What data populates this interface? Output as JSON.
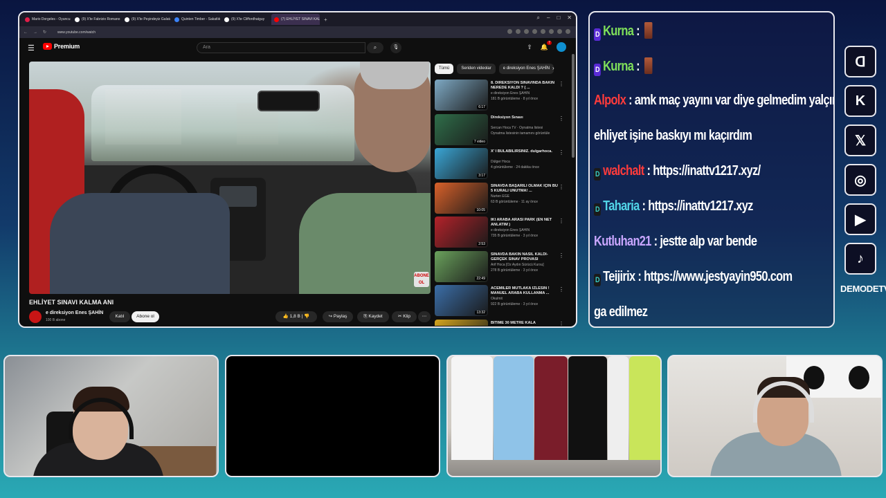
{
  "browser": {
    "tabs": [
      {
        "label": "Mario Dorgeles - Oyuncu",
        "color": "#e11d48"
      },
      {
        "label": "(9) X'te Fabrizio Romano",
        "color": "#ffffff"
      },
      {
        "label": "(9) X'te Peşindeyiz Galata",
        "color": "#ffffff"
      },
      {
        "label": "Quinten Timber - Sakatlık",
        "color": "#3b82f6"
      },
      {
        "label": "(9) X'te Cliffordhatguy",
        "color": "#ffffff"
      },
      {
        "label": "(7) EHLİYET SINAVI KALM",
        "color": "#ff0000"
      }
    ],
    "url": "www.youtube.com/watch"
  },
  "youtube": {
    "logo_text": "Premium",
    "search_placeholder": "Ara",
    "notification_count": "7",
    "video": {
      "title": "EHLİYET SINAVI KALMA ANI",
      "overlay_badge": "ABONE OL",
      "channel": "e direksiyon Enes ŞAHİN",
      "subscribers": "100 B abone",
      "join_label": "Katıl",
      "subscribe_label": "Abone ol",
      "likes": "1,8 B",
      "share_label": "Paylaş",
      "save_label": "Kaydet",
      "clip_label": "Klip"
    },
    "chips": [
      "Tümü",
      "Seriden videolar",
      "e direksiyon Enes ŞAHİN"
    ],
    "recommendations": [
      {
        "title": "8. DİREKSİYON SINAVINDA BAKIN NEREDE KALDI ? ( ...",
        "channel": "e direksiyon Enes ŞAHİN",
        "meta": "181 B görüntüleme · 8 yıl önce",
        "duration": "6:17",
        "color": "#7ea9c4"
      },
      {
        "title": "Direksiyon Sınavı",
        "channel": "Sercan Hoca TV · Oynatma listesi",
        "meta": "Oynatma listesinin tamamını görüntüle",
        "duration": "7 video",
        "color": "#2f6e4a"
      },
      {
        "title": "X' I BULABİLİRSİNİZ. dulgarhoca.",
        "channel": "Dülger Hoca",
        "meta": "4 görüntüleme · 24 dakika önce",
        "duration": "3:17",
        "color": "#3aa6d6"
      },
      {
        "title": "SINAVDA BAŞARILI OLMAK İÇİN BU 5 KURALI UNUTMA! ...",
        "channel": "Nurten EGE",
        "meta": "63 B görüntüleme · 11 ay önce",
        "duration": "10:05",
        "color": "#d9612a"
      },
      {
        "title": "İKİ ARABA ARASI PARK (EN NET ANLATIM )",
        "channel": "e direksiyon Enes ŞAHİN",
        "meta": "735 B görüntüleme · 3 yıl önce",
        "duration": "2:53",
        "color": "#b4222a"
      },
      {
        "title": "SINAVDA BAKIN NASIL KALDI- GERÇEK SINAV PROVASI",
        "channel": "Arif Hoca [Öz Aydın Sürücü Kursu]",
        "meta": "278 B görüntüleme · 3 yıl önce",
        "duration": "22:49",
        "color": "#6aa15c"
      },
      {
        "title": "ACEMİLER MUTLAKA İZLESİN ! MANUEL ARABA KULLANMA ...",
        "channel": "Okulmit",
        "meta": "922 B görüntüleme · 3 yıl önce",
        "duration": "13:32",
        "color": "#3b6ea8"
      },
      {
        "title": "BİTİME 30 METRE KALA",
        "channel": "",
        "meta": "",
        "duration": "",
        "color": "#d4a51f"
      }
    ]
  },
  "chat": {
    "messages": [
      {
        "user": "Kurna",
        "user_color": "#7fe05a",
        "badge": "D",
        "badge_style": "purple",
        "text": "",
        "emote": true
      },
      {
        "user": "Kurna",
        "user_color": "#7fe05a",
        "badge": "D",
        "badge_style": "purple",
        "text": "",
        "emote": true
      },
      {
        "user": "Alpolx",
        "user_color": "#ff3b3b",
        "badge": "",
        "badge_style": "",
        "text": "amk maç yayını var diye gelmedim yalçının",
        "emote": false
      },
      {
        "user": "",
        "user_color": "#ffffff",
        "badge": "",
        "badge_style": "",
        "text": "ehliyet işine baskıyı mı kaçırdım",
        "emote": false
      },
      {
        "user": "walchalt",
        "user_color": "#ff3b3b",
        "badge": "D",
        "badge_style": "teal",
        "text": "https://inattv1217.xyz/",
        "emote": false
      },
      {
        "user": "Taharia",
        "user_color": "#52d6e8",
        "badge": "D",
        "badge_style": "teal",
        "text": "https://inattv1217.xyz",
        "emote": false
      },
      {
        "user": "Kutluhan21",
        "user_color": "#c9a6ff",
        "badge": "",
        "badge_style": "",
        "text": "jestte alp var bende",
        "emote": false
      },
      {
        "user": "Teijirix",
        "user_color": "#ffffff",
        "badge": "D",
        "badge_style": "teal",
        "text": "https://www.jestyayin950.com",
        "emote": false
      },
      {
        "user": "",
        "user_color": "#ffffff",
        "badge": "",
        "badge_style": "",
        "text": "ga edilmez",
        "emote": false
      }
    ]
  },
  "social": {
    "icons": [
      "kick-d-icon",
      "kick-icon",
      "x-icon",
      "instagram-icon",
      "youtube-icon",
      "tiktok-icon"
    ],
    "glyphs": [
      "ᗡ",
      "K",
      "𝕏",
      "◎",
      "▶",
      "♪"
    ],
    "handle": "DEMODETV"
  }
}
